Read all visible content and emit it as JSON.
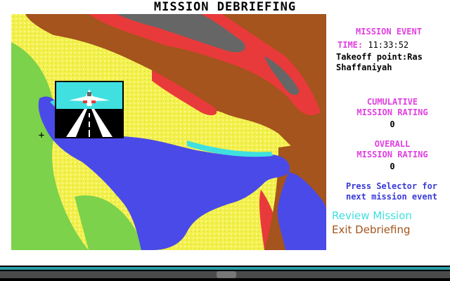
{
  "screen": {
    "title": "MISSION DEBRIEFING"
  },
  "map": {
    "colors": {
      "land": "#f4f04a",
      "lowland": "#7cd24a",
      "sea": "#4a4ae8",
      "mountain_brown": "#a4541c",
      "mountain_red": "#e83a3a",
      "peak_gray": "#666666",
      "water_cyan": "#40e0e0"
    },
    "marker_icon": "crosshair-icon",
    "marker_glyph": "+",
    "event_view": "jet-takeoff-runway"
  },
  "mission_event": {
    "header": "MISSION EVENT",
    "time_label": "TIME:",
    "time_value": "11:33:52",
    "description": "Takeoff point:Ras Shaffaniyah"
  },
  "cumulative": {
    "header_line1": "CUMULATIVE",
    "header_line2": "MISSION RATING",
    "value": "0"
  },
  "overall": {
    "header_line1": "OVERALL",
    "header_line2": "MISSION RATING",
    "value": "0"
  },
  "hint": {
    "line1": "Press Selector for",
    "line2": "next mission event"
  },
  "menu": {
    "review_label": "Review Mission",
    "exit_label": "Exit Debriefing"
  }
}
